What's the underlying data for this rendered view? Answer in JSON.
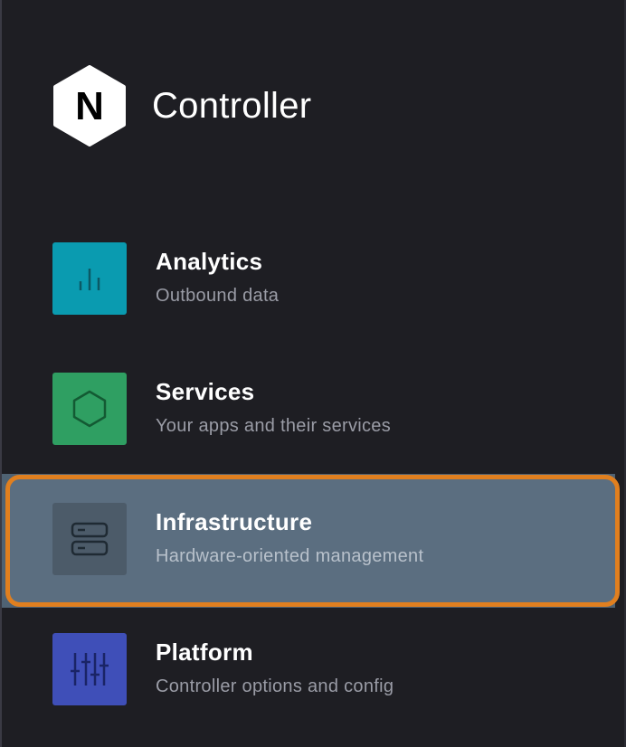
{
  "brand": {
    "logo_letter": "N",
    "title": "Controller"
  },
  "nav": {
    "items": [
      {
        "label": "Analytics",
        "subtitle": "Outbound data",
        "icon": "bar-chart-icon",
        "color": "#0a9bb0"
      },
      {
        "label": "Services",
        "subtitle": "Your apps and their services",
        "icon": "hexagon-icon",
        "color": "#2f9f62"
      },
      {
        "label": "Infrastructure",
        "subtitle": "Hardware-oriented management",
        "icon": "server-icon",
        "color": "#4c5b69",
        "selected": true
      },
      {
        "label": "Platform",
        "subtitle": "Controller options and config",
        "icon": "sliders-icon",
        "color": "#3f4fb8"
      }
    ]
  },
  "colors": {
    "background": "#1e1e23",
    "selected_background": "#5b6e80",
    "selected_outline": "#e07f1f",
    "subtitle_text": "#9a9ca6"
  }
}
